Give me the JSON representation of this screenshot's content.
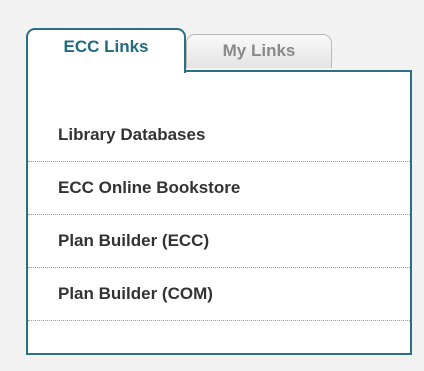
{
  "tabs": {
    "active_label": "ECC Links",
    "inactive_label": "My Links"
  },
  "links": [
    "Library Databases",
    "ECC Online Bookstore",
    "Plan Builder (ECC)",
    "Plan Builder (COM)"
  ],
  "colors": {
    "accent": "#2b6f83",
    "active_tab_text": "#1f6b80",
    "inactive_tab_text": "#8a8a8a",
    "link_text": "#333333"
  }
}
